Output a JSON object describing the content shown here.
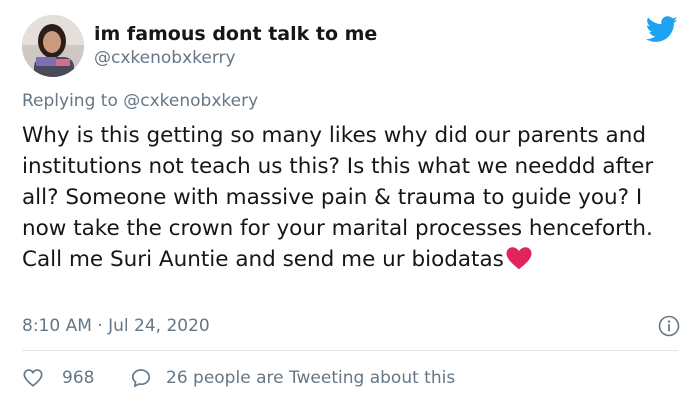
{
  "user": {
    "display_name": "im famous dont talk to me",
    "handle": "@cxkenobxkerry",
    "avatar_icon": "profile-photo"
  },
  "platform_icon": "twitter-bird-icon",
  "reply": {
    "prefix": "Replying to ",
    "mention": "@cxkenobxkery"
  },
  "tweet": {
    "text": "Why is this getting so many likes why did our parents and institutions not teach us this? Is this what we needdd after all? Someone with massive pain & trauma to guide you? I now take the crown for your marital processes henceforth. Call me Suri Auntie and send me ur biodatas",
    "emoji": "red-heart",
    "timestamp": "8:10 AM · Jul 24, 2020"
  },
  "actions": {
    "likes_count": "968",
    "tweeting_about": "26 people are Tweeting about this"
  },
  "colors": {
    "brand": "#1da1f2",
    "text": "#14171a",
    "muted": "#657786",
    "heart": "#e0245e",
    "divider": "#e1e8ed"
  }
}
